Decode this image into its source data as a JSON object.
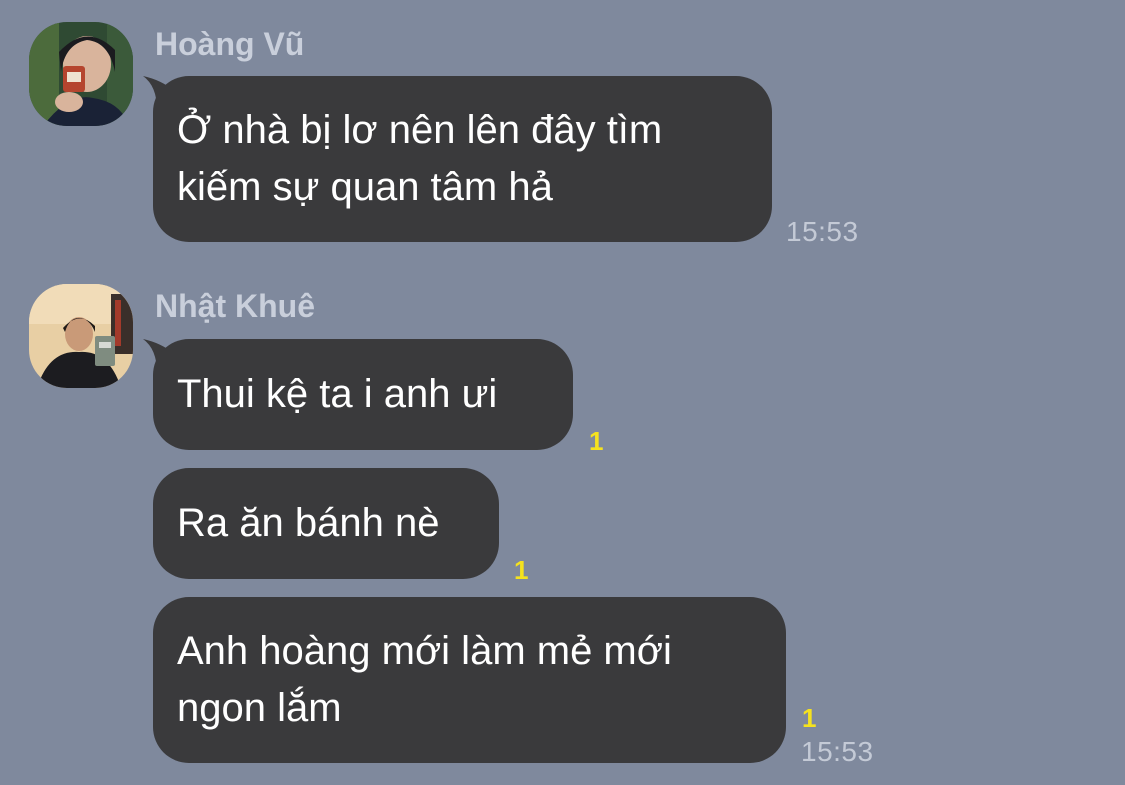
{
  "messages": [
    {
      "sender": "Hoàng Vũ",
      "avatar_icon": "profile-photo-icon",
      "bubbles": [
        {
          "lines": [
            "Ở nhà bị lơ nên lên đây tìm",
            "kiếm sự quan tâm hả"
          ],
          "read": "",
          "time": "15:53"
        }
      ]
    },
    {
      "sender": "Nhật Khuê",
      "avatar_icon": "profile-photo-icon",
      "bubbles": [
        {
          "lines": [
            "Thui kệ ta i anh ưi"
          ],
          "read": "1",
          "time": ""
        },
        {
          "lines": [
            "Ra ăn bánh nè"
          ],
          "read": "1",
          "time": ""
        },
        {
          "lines": [
            "Anh hoàng mới làm mẻ mới",
            "ngon lắm"
          ],
          "read": "1",
          "time": "15:53"
        }
      ]
    }
  ],
  "colors": {
    "background": "#7f899d",
    "bubble": "#3a3a3c",
    "bubble_text": "#ffffff",
    "name_text": "#c9cfdb",
    "read_count": "#f5e21e",
    "timestamp": "#c4cad6"
  }
}
